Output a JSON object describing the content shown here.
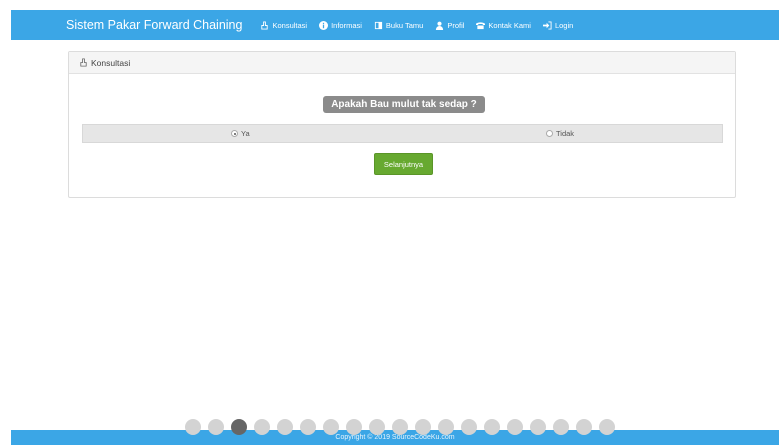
{
  "navbar": {
    "brand": "Sistem Pakar Forward Chaining",
    "items": [
      {
        "label": "Konsultasi",
        "icon": "hand-icon"
      },
      {
        "label": "Informasi",
        "icon": "info-icon"
      },
      {
        "label": "Buku Tamu",
        "icon": "book-icon"
      },
      {
        "label": "Profil",
        "icon": "user-icon"
      },
      {
        "label": "Kontak Kami",
        "icon": "phone-icon"
      },
      {
        "label": "Login",
        "icon": "login-icon"
      }
    ]
  },
  "panel": {
    "title": "Konsultasi",
    "question": "Apakah Bau mulut tak sedap ?",
    "options": [
      {
        "label": "Ya",
        "checked": true
      },
      {
        "label": "Tidak",
        "checked": false
      }
    ],
    "next_label": "Selanjutnya"
  },
  "footer": {
    "copyright": "Copyright © 2019 SourceCodeKu.com"
  },
  "slider": {
    "count": 19,
    "active_index": 2
  }
}
